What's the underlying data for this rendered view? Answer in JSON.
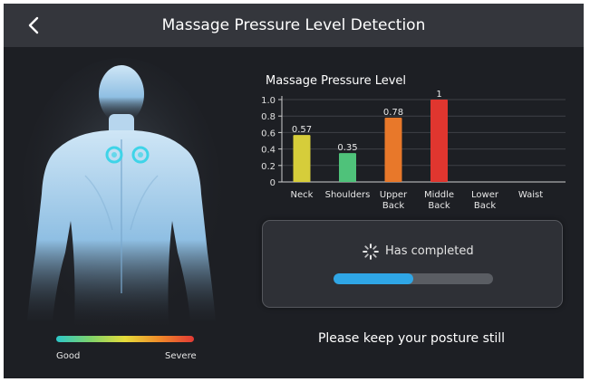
{
  "header": {
    "title": "Massage Pressure Level Detection",
    "back_icon": "chevron-left-icon"
  },
  "body_figure": {
    "image": "human-back-silhouette",
    "markers": [
      "left-shoulder-marker",
      "right-shoulder-marker"
    ],
    "marker_color": "#3fd4e8"
  },
  "scale": {
    "good_label": "Good",
    "severe_label": "Severe",
    "colors": [
      "#2cc7c9",
      "#7fd36b",
      "#e6dc3a",
      "#f08a2a",
      "#e23a35"
    ]
  },
  "chart_data": {
    "type": "bar",
    "title": "Massage Pressure Level",
    "categories": [
      [
        "Neck"
      ],
      [
        "Shoulders"
      ],
      [
        "Upper",
        "Back"
      ],
      [
        "Middle",
        "Back"
      ],
      [
        "Lower",
        "Back"
      ],
      [
        "Waist"
      ]
    ],
    "values": [
      0.57,
      0.35,
      0.78,
      1,
      null,
      null
    ],
    "value_labels": [
      "0.57",
      "0.35",
      "0.78",
      "1",
      "",
      ""
    ],
    "bar_colors": [
      "#d6cd3a",
      "#4fc27a",
      "#e8782a",
      "#e0362f",
      "",
      ""
    ],
    "ylim": [
      0,
      1.0
    ],
    "yticks": [
      "0",
      "0.2",
      "0.4",
      "0.6",
      "0.8",
      "1.0"
    ],
    "grid": true
  },
  "status": {
    "text": "Has completed",
    "spinner_icon": "loading-spinner-icon",
    "progress": 0.5,
    "progress_color": "#2fa6e6"
  },
  "message": "Please keep your posture still"
}
